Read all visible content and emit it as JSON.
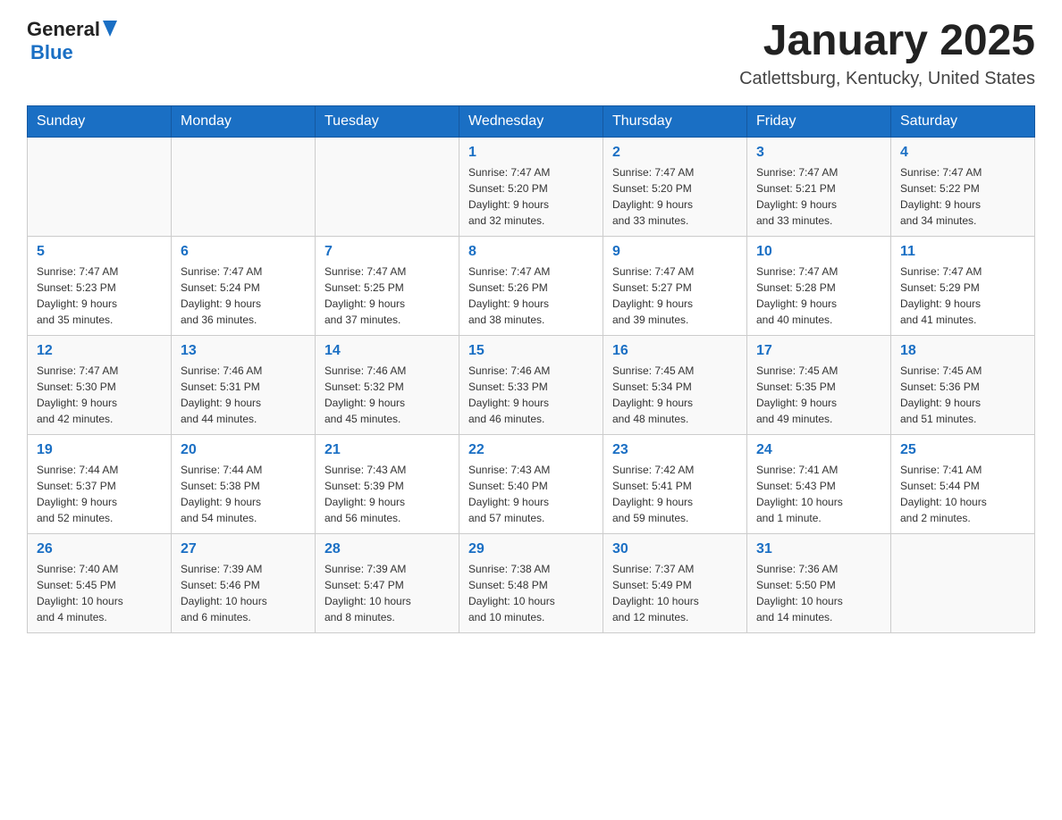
{
  "header": {
    "logo": {
      "text_general": "General",
      "triangle": "▶",
      "text_blue": "Blue"
    },
    "title": "January 2025",
    "subtitle": "Catlettsburg, Kentucky, United States"
  },
  "weekdays": [
    "Sunday",
    "Monday",
    "Tuesday",
    "Wednesday",
    "Thursday",
    "Friday",
    "Saturday"
  ],
  "weeks": [
    [
      {
        "day": "",
        "info": ""
      },
      {
        "day": "",
        "info": ""
      },
      {
        "day": "",
        "info": ""
      },
      {
        "day": "1",
        "info": "Sunrise: 7:47 AM\nSunset: 5:20 PM\nDaylight: 9 hours\nand 32 minutes."
      },
      {
        "day": "2",
        "info": "Sunrise: 7:47 AM\nSunset: 5:20 PM\nDaylight: 9 hours\nand 33 minutes."
      },
      {
        "day": "3",
        "info": "Sunrise: 7:47 AM\nSunset: 5:21 PM\nDaylight: 9 hours\nand 33 minutes."
      },
      {
        "day": "4",
        "info": "Sunrise: 7:47 AM\nSunset: 5:22 PM\nDaylight: 9 hours\nand 34 minutes."
      }
    ],
    [
      {
        "day": "5",
        "info": "Sunrise: 7:47 AM\nSunset: 5:23 PM\nDaylight: 9 hours\nand 35 minutes."
      },
      {
        "day": "6",
        "info": "Sunrise: 7:47 AM\nSunset: 5:24 PM\nDaylight: 9 hours\nand 36 minutes."
      },
      {
        "day": "7",
        "info": "Sunrise: 7:47 AM\nSunset: 5:25 PM\nDaylight: 9 hours\nand 37 minutes."
      },
      {
        "day": "8",
        "info": "Sunrise: 7:47 AM\nSunset: 5:26 PM\nDaylight: 9 hours\nand 38 minutes."
      },
      {
        "day": "9",
        "info": "Sunrise: 7:47 AM\nSunset: 5:27 PM\nDaylight: 9 hours\nand 39 minutes."
      },
      {
        "day": "10",
        "info": "Sunrise: 7:47 AM\nSunset: 5:28 PM\nDaylight: 9 hours\nand 40 minutes."
      },
      {
        "day": "11",
        "info": "Sunrise: 7:47 AM\nSunset: 5:29 PM\nDaylight: 9 hours\nand 41 minutes."
      }
    ],
    [
      {
        "day": "12",
        "info": "Sunrise: 7:47 AM\nSunset: 5:30 PM\nDaylight: 9 hours\nand 42 minutes."
      },
      {
        "day": "13",
        "info": "Sunrise: 7:46 AM\nSunset: 5:31 PM\nDaylight: 9 hours\nand 44 minutes."
      },
      {
        "day": "14",
        "info": "Sunrise: 7:46 AM\nSunset: 5:32 PM\nDaylight: 9 hours\nand 45 minutes."
      },
      {
        "day": "15",
        "info": "Sunrise: 7:46 AM\nSunset: 5:33 PM\nDaylight: 9 hours\nand 46 minutes."
      },
      {
        "day": "16",
        "info": "Sunrise: 7:45 AM\nSunset: 5:34 PM\nDaylight: 9 hours\nand 48 minutes."
      },
      {
        "day": "17",
        "info": "Sunrise: 7:45 AM\nSunset: 5:35 PM\nDaylight: 9 hours\nand 49 minutes."
      },
      {
        "day": "18",
        "info": "Sunrise: 7:45 AM\nSunset: 5:36 PM\nDaylight: 9 hours\nand 51 minutes."
      }
    ],
    [
      {
        "day": "19",
        "info": "Sunrise: 7:44 AM\nSunset: 5:37 PM\nDaylight: 9 hours\nand 52 minutes."
      },
      {
        "day": "20",
        "info": "Sunrise: 7:44 AM\nSunset: 5:38 PM\nDaylight: 9 hours\nand 54 minutes."
      },
      {
        "day": "21",
        "info": "Sunrise: 7:43 AM\nSunset: 5:39 PM\nDaylight: 9 hours\nand 56 minutes."
      },
      {
        "day": "22",
        "info": "Sunrise: 7:43 AM\nSunset: 5:40 PM\nDaylight: 9 hours\nand 57 minutes."
      },
      {
        "day": "23",
        "info": "Sunrise: 7:42 AM\nSunset: 5:41 PM\nDaylight: 9 hours\nand 59 minutes."
      },
      {
        "day": "24",
        "info": "Sunrise: 7:41 AM\nSunset: 5:43 PM\nDaylight: 10 hours\nand 1 minute."
      },
      {
        "day": "25",
        "info": "Sunrise: 7:41 AM\nSunset: 5:44 PM\nDaylight: 10 hours\nand 2 minutes."
      }
    ],
    [
      {
        "day": "26",
        "info": "Sunrise: 7:40 AM\nSunset: 5:45 PM\nDaylight: 10 hours\nand 4 minutes."
      },
      {
        "day": "27",
        "info": "Sunrise: 7:39 AM\nSunset: 5:46 PM\nDaylight: 10 hours\nand 6 minutes."
      },
      {
        "day": "28",
        "info": "Sunrise: 7:39 AM\nSunset: 5:47 PM\nDaylight: 10 hours\nand 8 minutes."
      },
      {
        "day": "29",
        "info": "Sunrise: 7:38 AM\nSunset: 5:48 PM\nDaylight: 10 hours\nand 10 minutes."
      },
      {
        "day": "30",
        "info": "Sunrise: 7:37 AM\nSunset: 5:49 PM\nDaylight: 10 hours\nand 12 minutes."
      },
      {
        "day": "31",
        "info": "Sunrise: 7:36 AM\nSunset: 5:50 PM\nDaylight: 10 hours\nand 14 minutes."
      },
      {
        "day": "",
        "info": ""
      }
    ]
  ]
}
